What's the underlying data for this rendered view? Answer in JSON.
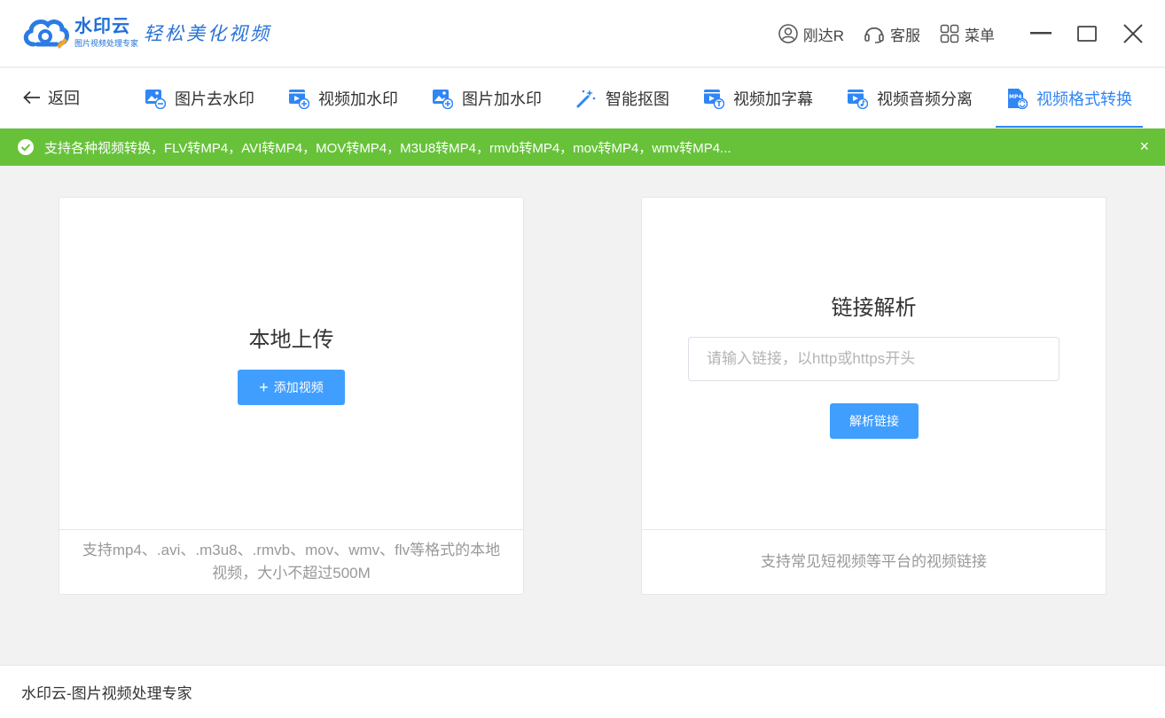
{
  "app": {
    "logo_name": "水印云",
    "logo_sub": "图片视频处理专家",
    "slogan": "轻松美化视频"
  },
  "titlebar": {
    "user_label": "刚达R",
    "service_label": "客服",
    "menu_label": "菜单"
  },
  "nav": {
    "back_label": "返回",
    "tabs": [
      {
        "label": "图片去水印",
        "icon": "image-remove-icon"
      },
      {
        "label": "视频加水印",
        "icon": "video-add-icon"
      },
      {
        "label": "图片加水印",
        "icon": "image-add-icon"
      },
      {
        "label": "智能抠图",
        "icon": "magic-wand-icon"
      },
      {
        "label": "视频加字幕",
        "icon": "video-subtitle-icon"
      },
      {
        "label": "视频音频分离",
        "icon": "video-audio-icon"
      },
      {
        "label": "视频格式转换",
        "icon": "mp4-file-icon",
        "badge": "MP4"
      }
    ],
    "active_tab": 6
  },
  "banner": {
    "text": "支持各种视频转换，FLV转MP4，AVI转MP4，MOV转MP4，M3U8转MP4，rmvb转MP4，mov转MP4，wmv转MP4...",
    "close": "×"
  },
  "local_upload": {
    "title": "本地上传",
    "button_label": "添加视频",
    "footer_text": "支持mp4、.avi、.m3u8、.rmvb、mov、wmv、flv等格式的本地视频，大小不超过500M"
  },
  "link_parse": {
    "title": "链接解析",
    "input_placeholder": "请输入链接，以http或https开头",
    "input_value": "",
    "button_label": "解析链接",
    "footer_text": "支持常见短视频等平台的视频链接"
  },
  "footer": {
    "text": "水印云-图片视频处理专家"
  },
  "colors": {
    "accent": "#409eff",
    "active_tab": "#2f86f6",
    "banner": "#67c23a",
    "brand": "#1e6fd9"
  }
}
